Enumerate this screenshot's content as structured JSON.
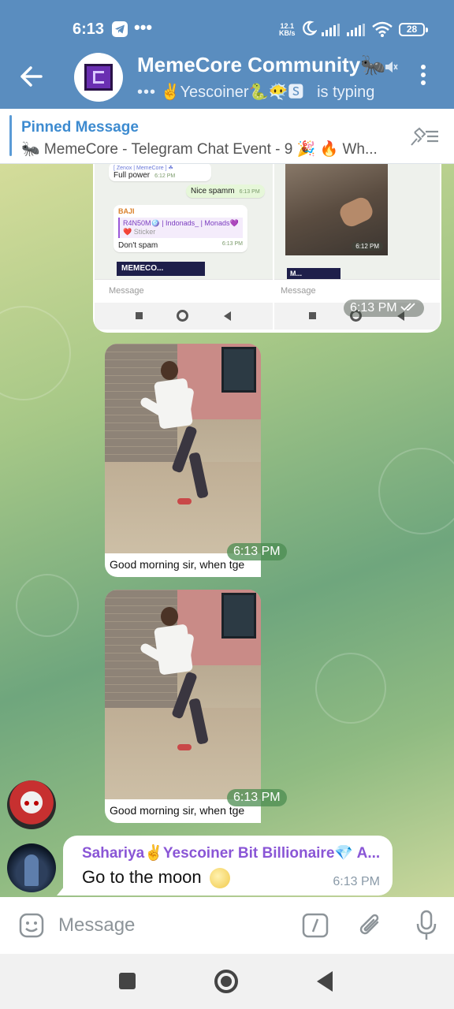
{
  "status_bar": {
    "time": "6:13",
    "overflow": "•••",
    "net_speed_value": "12.1",
    "net_speed_unit": "KB/s",
    "battery": "28",
    "icons": [
      "telegram-icon",
      "moon-icon",
      "signal-icon",
      "signal-icon",
      "wifi-icon",
      "battery-icon"
    ]
  },
  "header": {
    "title": "MemeCore Community🐜",
    "typing_dots": "•••",
    "subtitle_user": "✌Yescoiner🐍😶‍🌫️🆂",
    "subtitle_status": "is typing",
    "accent": "#5a8dbf"
  },
  "pinned": {
    "title": "Pinned Message",
    "text": "🐜 MemeCore - Telegram Chat Event - 9 🎉 🔥 Wh..."
  },
  "album": {
    "left_shot": {
      "top_label": "[ Zenox | MemeCore ] ☘",
      "msg1": "Full power",
      "msg1_time": "6:12 PM",
      "msg2": "Nice spamm",
      "msg2_time": "6:13 PM",
      "reply_name": "BAJI",
      "reply_quote": "R4N50M🪩 | Indonads_ | Monads💜",
      "reply_sticker": "❤️ Sticker",
      "reply_text": "Don't spam",
      "reply_time": "6:13 PM",
      "sticker_text": "MEMECO...",
      "input_placeholder": "Message"
    },
    "right_shot": {
      "photo_time": "6:12 PM",
      "sticker_text": "M...",
      "input_placeholder": "Message"
    },
    "time": "6:13 PM"
  },
  "messages": [
    {
      "caption": "Good morning sir, when tge",
      "time": "6:13 PM"
    },
    {
      "caption": "Good morning sir, when tge",
      "time": "6:13 PM"
    },
    {
      "sender": "Sahariya✌Yescoiner Bit Billionaire💎 A...",
      "text": "Go to the moon",
      "time": "6:13 PM"
    }
  ],
  "composer": {
    "placeholder": "Message"
  }
}
